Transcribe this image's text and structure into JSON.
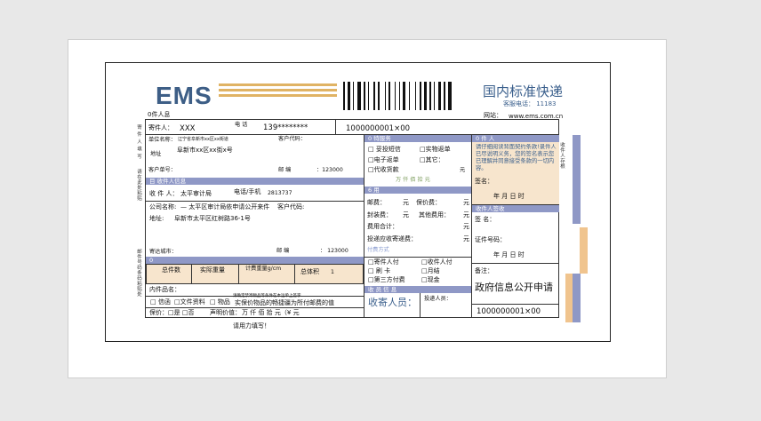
{
  "header": {
    "brand": "EMS",
    "title": "国内标准快递",
    "hotline": "客服电话：  11183",
    "tracking": "1000000001×00",
    "website_label": "网站：",
    "website": "www.ems.com.cn"
  },
  "sender": {
    "section": "0件人息",
    "name_label": "寄件人：",
    "name": "XXX",
    "phone_label": "电  话",
    "phone": "139********",
    "company_label": "单位名称：",
    "company": "辽宁省阜新市xx区xx街道",
    "customer_code": "客户代码：",
    "address_label": "地址",
    "address": "阜新市xx区xx街x号",
    "order_label": "客户单号：",
    "post_label": "邮     编",
    "post": "：123000"
  },
  "special": {
    "section": "0 特服务",
    "options": [
      "□ 妥投短信",
      "□实物返单",
      "□电子返单",
      "□其它：",
      "□代收货款"
    ],
    "amount_label": "万  仟  佰  拾  元"
  },
  "delivery": {
    "section": "0  件  人",
    "notice": "请仔细阅读背面契约条款!录件人已尽说明义务，您的签名表示您已理解并同意接受条款的一切内容。",
    "sign_label": "签名：",
    "date": "年     月     日     时"
  },
  "recipient": {
    "section": "目  收件人信息",
    "name_label": "收 件 人：",
    "name": "太平审计局",
    "phone_label": "电话/手机",
    "phone": "2813737",
    "company_label": "公司名称:",
    "company": "—  太平区审计局依申请公开来件",
    "customer_code": "客户代码:",
    "address_label": "地址:",
    "address": "阜新市太平区红树路36-1号",
    "city_label": "寄达城市：",
    "post_label": "邮     编",
    "post": "：  123000"
  },
  "fees": {
    "section": "6     用",
    "postage": "邮费：",
    "insurance": "保价费：",
    "packing": "封装费：",
    "other": "其他费用：",
    "total": "费用合计：",
    "cod_fee": "投递应收寄递费：",
    "yuan": "元",
    "payment_section": "付费方式",
    "payment": [
      "□寄件人付",
      "□收件人付",
      "□ 刷 卡",
      "□月结",
      "□第三方付费",
      "□现金"
    ]
  },
  "receipt": {
    "section": "收件人签收",
    "sign_label": "签  名：",
    "id_label": "证件号码：",
    "date": "年     月     日     时",
    "remark_label": "备注：",
    "remark": "政府信息公开申请",
    "tracking": "1000000001×00"
  },
  "parcel": {
    "section": "0",
    "pieces": "总件数",
    "weight": "实际重量",
    "vol_weight": "计费重量g/cm",
    "volume": "总体积",
    "volume_val": "1",
    "contents_label": "内件品名：",
    "types": [
      "□ 信函",
      "□文件资料",
      "□ 物品"
    ],
    "notice_a": "请确定禁寄物品等条件在本运单上签字",
    "notice_b": "实保价物品的畅捷疆为所付邮费的值",
    "insure_label": "保价：□是 □否",
    "declared_label": "声明价值：",
    "declared": "万  仟  佰  拾  元（¥          元",
    "footer": "请用力填写！"
  },
  "collector": {
    "section": "收 员 信 息",
    "name": "收寄人员：",
    "courier": "投递人员："
  },
  "margin": {
    "left_top": "寄\n件\n人\n填\n写",
    "left_mid": "请在此处粘贴",
    "left_bot": "邮件号码条码粘贴处",
    "right": "收件人存根"
  },
  "colors": {
    "brand": "#3d5e86",
    "header_bar": "#8f98c6",
    "peach": "#f7e5cd",
    "stripe": "#e0b364"
  }
}
